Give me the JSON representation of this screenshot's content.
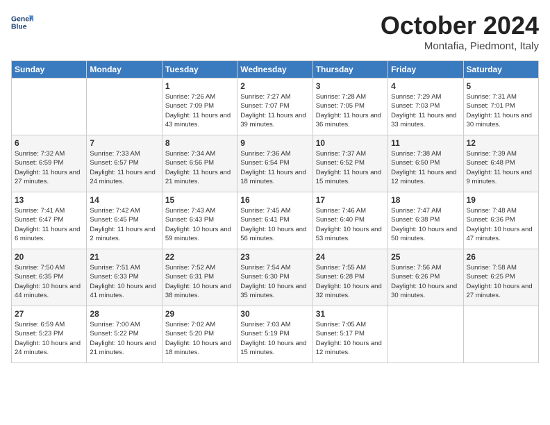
{
  "header": {
    "logo_line1": "General",
    "logo_line2": "Blue",
    "month": "October 2024",
    "location": "Montafia, Piedmont, Italy"
  },
  "days_of_week": [
    "Sunday",
    "Monday",
    "Tuesday",
    "Wednesday",
    "Thursday",
    "Friday",
    "Saturday"
  ],
  "weeks": [
    [
      {
        "day": "",
        "info": ""
      },
      {
        "day": "",
        "info": ""
      },
      {
        "day": "1",
        "info": "Sunrise: 7:26 AM\nSunset: 7:09 PM\nDaylight: 11 hours and 43 minutes."
      },
      {
        "day": "2",
        "info": "Sunrise: 7:27 AM\nSunset: 7:07 PM\nDaylight: 11 hours and 39 minutes."
      },
      {
        "day": "3",
        "info": "Sunrise: 7:28 AM\nSunset: 7:05 PM\nDaylight: 11 hours and 36 minutes."
      },
      {
        "day": "4",
        "info": "Sunrise: 7:29 AM\nSunset: 7:03 PM\nDaylight: 11 hours and 33 minutes."
      },
      {
        "day": "5",
        "info": "Sunrise: 7:31 AM\nSunset: 7:01 PM\nDaylight: 11 hours and 30 minutes."
      }
    ],
    [
      {
        "day": "6",
        "info": "Sunrise: 7:32 AM\nSunset: 6:59 PM\nDaylight: 11 hours and 27 minutes."
      },
      {
        "day": "7",
        "info": "Sunrise: 7:33 AM\nSunset: 6:57 PM\nDaylight: 11 hours and 24 minutes."
      },
      {
        "day": "8",
        "info": "Sunrise: 7:34 AM\nSunset: 6:56 PM\nDaylight: 11 hours and 21 minutes."
      },
      {
        "day": "9",
        "info": "Sunrise: 7:36 AM\nSunset: 6:54 PM\nDaylight: 11 hours and 18 minutes."
      },
      {
        "day": "10",
        "info": "Sunrise: 7:37 AM\nSunset: 6:52 PM\nDaylight: 11 hours and 15 minutes."
      },
      {
        "day": "11",
        "info": "Sunrise: 7:38 AM\nSunset: 6:50 PM\nDaylight: 11 hours and 12 minutes."
      },
      {
        "day": "12",
        "info": "Sunrise: 7:39 AM\nSunset: 6:48 PM\nDaylight: 11 hours and 9 minutes."
      }
    ],
    [
      {
        "day": "13",
        "info": "Sunrise: 7:41 AM\nSunset: 6:47 PM\nDaylight: 11 hours and 6 minutes."
      },
      {
        "day": "14",
        "info": "Sunrise: 7:42 AM\nSunset: 6:45 PM\nDaylight: 11 hours and 2 minutes."
      },
      {
        "day": "15",
        "info": "Sunrise: 7:43 AM\nSunset: 6:43 PM\nDaylight: 10 hours and 59 minutes."
      },
      {
        "day": "16",
        "info": "Sunrise: 7:45 AM\nSunset: 6:41 PM\nDaylight: 10 hours and 56 minutes."
      },
      {
        "day": "17",
        "info": "Sunrise: 7:46 AM\nSunset: 6:40 PM\nDaylight: 10 hours and 53 minutes."
      },
      {
        "day": "18",
        "info": "Sunrise: 7:47 AM\nSunset: 6:38 PM\nDaylight: 10 hours and 50 minutes."
      },
      {
        "day": "19",
        "info": "Sunrise: 7:48 AM\nSunset: 6:36 PM\nDaylight: 10 hours and 47 minutes."
      }
    ],
    [
      {
        "day": "20",
        "info": "Sunrise: 7:50 AM\nSunset: 6:35 PM\nDaylight: 10 hours and 44 minutes."
      },
      {
        "day": "21",
        "info": "Sunrise: 7:51 AM\nSunset: 6:33 PM\nDaylight: 10 hours and 41 minutes."
      },
      {
        "day": "22",
        "info": "Sunrise: 7:52 AM\nSunset: 6:31 PM\nDaylight: 10 hours and 38 minutes."
      },
      {
        "day": "23",
        "info": "Sunrise: 7:54 AM\nSunset: 6:30 PM\nDaylight: 10 hours and 35 minutes."
      },
      {
        "day": "24",
        "info": "Sunrise: 7:55 AM\nSunset: 6:28 PM\nDaylight: 10 hours and 32 minutes."
      },
      {
        "day": "25",
        "info": "Sunrise: 7:56 AM\nSunset: 6:26 PM\nDaylight: 10 hours and 30 minutes."
      },
      {
        "day": "26",
        "info": "Sunrise: 7:58 AM\nSunset: 6:25 PM\nDaylight: 10 hours and 27 minutes."
      }
    ],
    [
      {
        "day": "27",
        "info": "Sunrise: 6:59 AM\nSunset: 5:23 PM\nDaylight: 10 hours and 24 minutes."
      },
      {
        "day": "28",
        "info": "Sunrise: 7:00 AM\nSunset: 5:22 PM\nDaylight: 10 hours and 21 minutes."
      },
      {
        "day": "29",
        "info": "Sunrise: 7:02 AM\nSunset: 5:20 PM\nDaylight: 10 hours and 18 minutes."
      },
      {
        "day": "30",
        "info": "Sunrise: 7:03 AM\nSunset: 5:19 PM\nDaylight: 10 hours and 15 minutes."
      },
      {
        "day": "31",
        "info": "Sunrise: 7:05 AM\nSunset: 5:17 PM\nDaylight: 10 hours and 12 minutes."
      },
      {
        "day": "",
        "info": ""
      },
      {
        "day": "",
        "info": ""
      }
    ]
  ]
}
